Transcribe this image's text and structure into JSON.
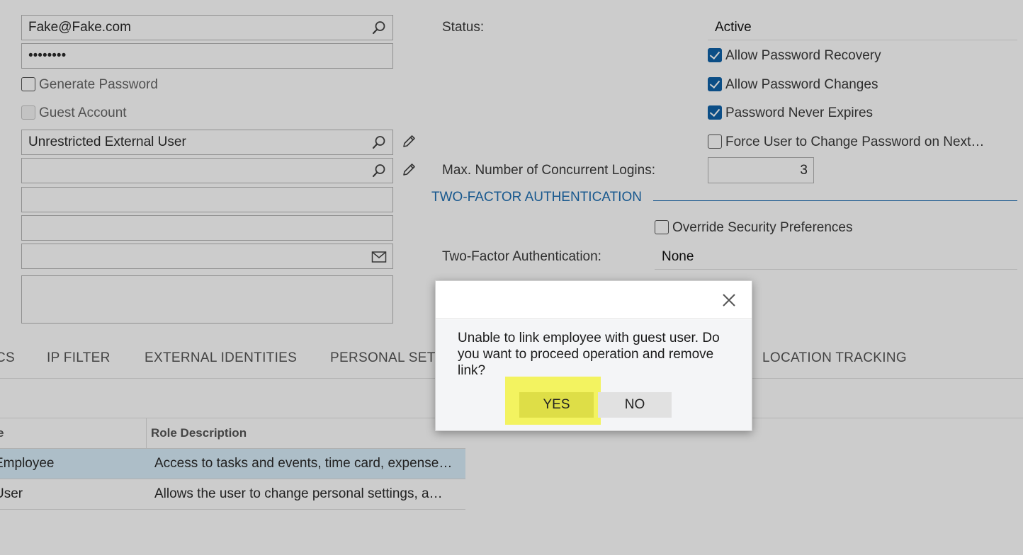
{
  "form": {
    "email": "Fake@Fake.com",
    "password": "••••••••",
    "generate_password": "Generate Password",
    "guest_account": "Guest Account",
    "user_type": "Unrestricted External User",
    "linked_entity": "",
    "field_a": "",
    "field_b": "",
    "email_field": "",
    "comment": ""
  },
  "status": {
    "label": "Status:",
    "value": "Active"
  },
  "options": {
    "allow_recovery": "Allow Password Recovery",
    "allow_changes": "Allow Password Changes",
    "never_expires": "Password Never Expires",
    "force_change": "Force User to Change Password on Next…"
  },
  "logins": {
    "label": "Max. Number of Concurrent Logins:",
    "value": "3"
  },
  "two_factor": {
    "section_title": "TWO-FACTOR AUTHENTICATION",
    "override": "Override Security Preferences",
    "label": "Two-Factor Authentication:",
    "value": "None"
  },
  "tabs": [
    "CS",
    "IP FILTER",
    "EXTERNAL IDENTITIES",
    "PERSONAL SETTINGS",
    "LOCATION TRACKING"
  ],
  "grid": {
    "headers": [
      "e",
      "Role Description"
    ],
    "rows": [
      {
        "name": "Employee",
        "description": "Access to tasks and events, time card, expense receipts"
      },
      {
        "name": "User",
        "description": "Allows the user to change personal settings, a…"
      }
    ]
  },
  "dialog": {
    "message": "Unable to link employee with guest user. Do you want to proceed operation and remove link?",
    "yes_label": "YES",
    "no_label": "NO"
  },
  "colors": {
    "accent": "#1f6fb2",
    "checkbox_checked": "#0f62a8",
    "highlight": "#f2f23a"
  }
}
